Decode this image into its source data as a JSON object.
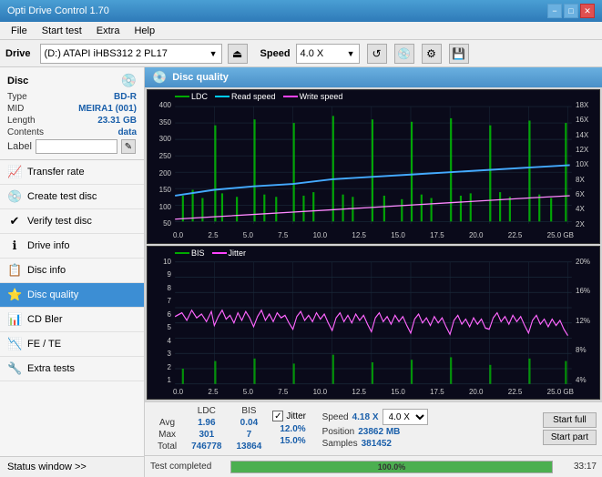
{
  "titleBar": {
    "title": "Opti Drive Control 1.70",
    "minBtn": "−",
    "maxBtn": "□",
    "closeBtn": "✕"
  },
  "menuBar": {
    "items": [
      "File",
      "Start test",
      "Extra",
      "Help"
    ]
  },
  "driveBar": {
    "label": "Drive",
    "driveText": "(D:)  ATAPI iHBS312  2 PL17",
    "speedLabel": "Speed",
    "speedValue": "4.0 X"
  },
  "disc": {
    "title": "Disc",
    "type": {
      "key": "Type",
      "val": "BD-R"
    },
    "mid": {
      "key": "MID",
      "val": "MEIRA1 (001)"
    },
    "length": {
      "key": "Length",
      "val": "23.31 GB"
    },
    "contents": {
      "key": "Contents",
      "val": "data"
    },
    "label": {
      "key": "Label",
      "placeholder": ""
    }
  },
  "navItems": [
    {
      "id": "transfer-rate",
      "label": "Transfer rate",
      "icon": "📈"
    },
    {
      "id": "create-test-disc",
      "label": "Create test disc",
      "icon": "💿"
    },
    {
      "id": "verify-test-disc",
      "label": "Verify test disc",
      "icon": "✔"
    },
    {
      "id": "drive-info",
      "label": "Drive info",
      "icon": "ℹ"
    },
    {
      "id": "disc-info",
      "label": "Disc info",
      "icon": "📋"
    },
    {
      "id": "disc-quality",
      "label": "Disc quality",
      "icon": "⭐",
      "active": true
    },
    {
      "id": "cd-bler",
      "label": "CD Bler",
      "icon": "📊"
    },
    {
      "id": "fe-te",
      "label": "FE / TE",
      "icon": "📉"
    },
    {
      "id": "extra-tests",
      "label": "Extra tests",
      "icon": "🔧"
    }
  ],
  "statusWindow": {
    "label": "Status window >> "
  },
  "discQuality": {
    "title": "Disc quality",
    "legend": {
      "ldc": "LDC",
      "readSpeed": "Read speed",
      "writeSpeed": "Write speed"
    },
    "legend2": {
      "bis": "BIS",
      "jitter": "Jitter"
    },
    "chart1": {
      "yLeft": [
        "400",
        "350",
        "300",
        "250",
        "200",
        "150",
        "100",
        "50"
      ],
      "yRight": [
        "18X",
        "16X",
        "14X",
        "12X",
        "10X",
        "8X",
        "6X",
        "4X",
        "2X"
      ],
      "xLabels": [
        "0.0",
        "2.5",
        "5.0",
        "7.5",
        "10.0",
        "12.5",
        "15.0",
        "17.5",
        "20.0",
        "22.5",
        "25.0 GB"
      ]
    },
    "chart2": {
      "yLeft": [
        "10",
        "9",
        "8",
        "7",
        "6",
        "5",
        "4",
        "3",
        "2",
        "1"
      ],
      "yRight": [
        "20%",
        "16%",
        "12%",
        "8%",
        "4%"
      ],
      "xLabels": [
        "0.0",
        "2.5",
        "5.0",
        "7.5",
        "10.0",
        "12.5",
        "15.0",
        "17.5",
        "20.0",
        "22.5",
        "25.0 GB"
      ]
    }
  },
  "stats": {
    "headers": [
      "LDC",
      "BIS",
      "",
      "Jitter",
      "Speed"
    ],
    "avg": {
      "ldc": "1.96",
      "bis": "0.04",
      "jitter": "12.0%",
      "speed": "4.18 X"
    },
    "max": {
      "ldc": "301",
      "bis": "7",
      "jitter": "15.0%",
      "position": "23862 MB"
    },
    "total": {
      "ldc": "746778",
      "bis": "13864",
      "samples": "381452"
    },
    "jitterChecked": true,
    "jitterLabel": "Jitter",
    "speedLabel": "Speed",
    "speedDropdown": "4.0 X",
    "positionLabel": "Position",
    "samplesLabel": "Samples",
    "avgLabel": "Avg",
    "maxLabel": "Max",
    "totalLabel": "Total",
    "buttons": {
      "startFull": "Start full",
      "startPart": "Start part"
    }
  },
  "bottomBar": {
    "statusText": "Test completed",
    "progress": 100,
    "progressLabel": "100.0%",
    "timeText": "33:17"
  }
}
